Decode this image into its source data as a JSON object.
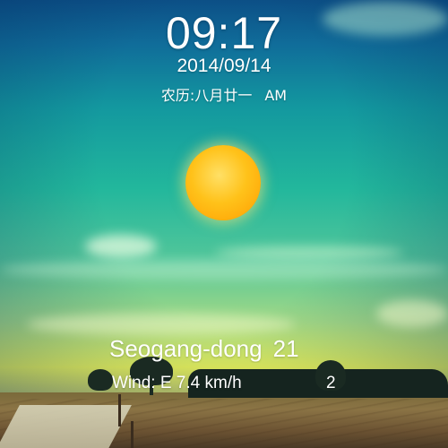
{
  "clock": {
    "time": "09:17",
    "date": "2014/09/14",
    "lunar_date": "农历:八月廿一",
    "meridiem": "AM"
  },
  "weather": {
    "location": "Seogang-dong",
    "temperature": "21",
    "wind": "Wind: E 7.4 km/h",
    "secondary_value": "2",
    "condition_icon": "sun-icon"
  },
  "colors": {
    "sun_core": "#ffc21a",
    "text": "#ffffff"
  }
}
